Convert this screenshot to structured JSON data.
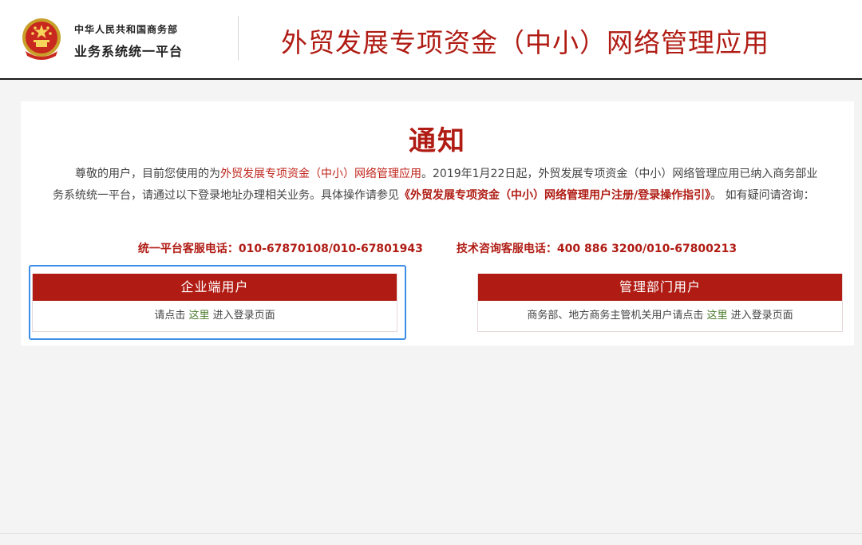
{
  "header": {
    "org_line1": "中华人民共和国商务部",
    "org_line2": "业务系统统一平台",
    "app_title": "外贸发展专项资金（中小）网络管理应用"
  },
  "notice": {
    "title": "通知",
    "body_part1": "尊敬的用户，目前您使用的为",
    "body_app_name": "外贸发展专项资金（中小）网络管理应用",
    "body_part2": "。2019年1月22日起，外贸发展专项资金（中小）网络管理应用已纳入商务部业务系统统一平台，请通过以下登录地址办理相关业务。具体操作请参见",
    "body_guide": "《外贸发展专项资金（中小）网络管理用户注册/登录操作指引》",
    "body_part3": "。 如有疑问请咨询："
  },
  "hotlines": {
    "platform": "统一平台客服电话：010-67870108/010-67801943",
    "tech": "技术咨询客服电话：400 886 3200/010-67800213"
  },
  "cards": {
    "enterprise": {
      "title": "企业端用户",
      "prefix": "请点击",
      "link": "这里",
      "suffix": "进入登录页面"
    },
    "admin": {
      "title": "管理部门用户",
      "prefix": "商务部、地方商务主管机关用户请点击",
      "link": "这里",
      "suffix": "进入登录页面"
    }
  },
  "colors": {
    "brand_red": "#b01c14",
    "focus_blue": "#3d8ee6",
    "link_green": "#4a7a2a"
  },
  "icons": {
    "emblem": "national-emblem-icon"
  }
}
